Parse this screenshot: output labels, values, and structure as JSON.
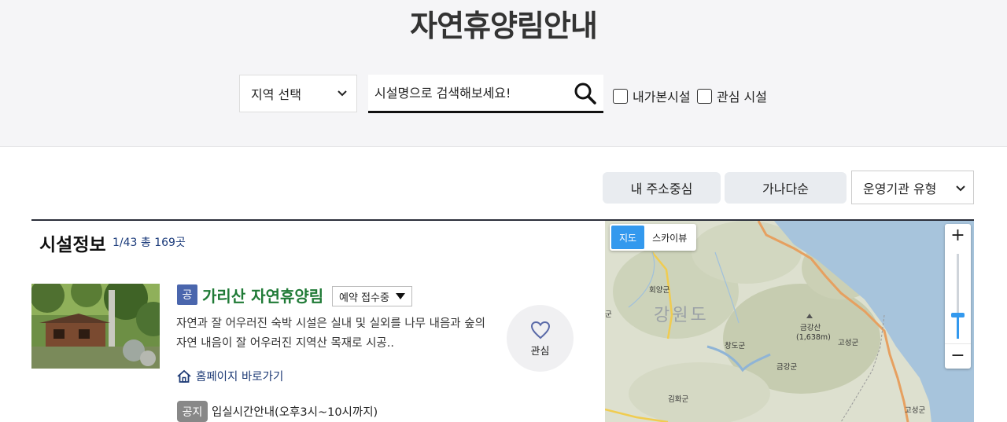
{
  "header": {
    "title": "자연휴양림안내"
  },
  "search": {
    "region_select": "지역 선택",
    "placeholder": "시설명으로 검색해보세요!",
    "checkbox_visited": "내가본시설",
    "checkbox_favorite": "관심 시설"
  },
  "sort": {
    "address_label": "내 주소중심",
    "alpha_label": "가나다순",
    "org_type_select": "운영기관 유형"
  },
  "results": {
    "heading": "시설정보",
    "count": "1/43 총 169곳"
  },
  "facility": {
    "badge": "공",
    "name": "가리산 자연휴양림",
    "status": "예약 접수중",
    "description": "자연과 잘 어우러진 숙박 시설은 실내 및 실외를 나무 내음과 숲의 자연 내음이 잘 어우러진 지역산 목재로 시공..",
    "favorite_label": "관심",
    "homepage_link": "홈페이지 바로가기",
    "notice_badge": "공지",
    "notice_text": "입실시간안내(오후3시~10시까지)"
  },
  "map": {
    "type_map": "지도",
    "type_skyview": "스카이뷰",
    "zoom_in": "+",
    "zoom_out": "−",
    "zoom_level": 0.72,
    "region_label": "강원도",
    "labels": [
      "회양군",
      "금강산",
      "(1,638m)",
      "고성군",
      "창도군",
      "금강군",
      "김화군",
      "고성군",
      "군"
    ]
  },
  "colors": {
    "header_bg": "#f5f5f7",
    "facility_name": "#1f7a36",
    "badge_public": "#4a66ad",
    "map_active": "#3399ee",
    "link": "#1d3a75"
  }
}
